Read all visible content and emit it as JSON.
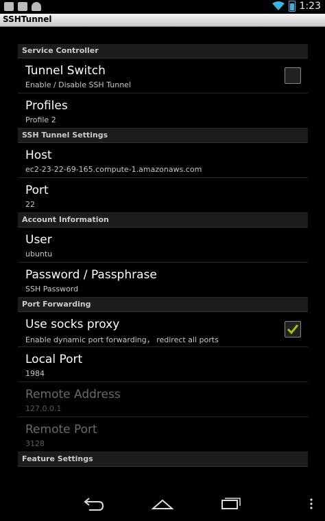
{
  "status_bar": {
    "time": "1:23",
    "left_icons": [
      "gallery-icon",
      "keyboard-icon",
      "android-icon"
    ],
    "right_icons": [
      "wifi-icon",
      "battery-icon"
    ]
  },
  "app": {
    "title": "SSHTunnel"
  },
  "sections": [
    {
      "header": "Service Controller",
      "items": [
        {
          "title": "Tunnel Switch",
          "summary": "Enable / Disable SSH Tunnel",
          "checkbox": true,
          "checked": false
        },
        {
          "title": "Profiles",
          "summary": "Profile 2"
        }
      ]
    },
    {
      "header": "SSH Tunnel Settings",
      "items": [
        {
          "title": "Host",
          "summary": "ec2-23-22-69-165.compute-1.amazonaws.com"
        },
        {
          "title": "Port",
          "summary": "22"
        }
      ]
    },
    {
      "header": "Account Information",
      "items": [
        {
          "title": "User",
          "summary": "ubuntu"
        },
        {
          "title": "Password / Passphrase",
          "summary": "SSH Password"
        }
      ]
    },
    {
      "header": "Port Forwarding",
      "items": [
        {
          "title": "Use socks proxy",
          "summary": "Enable dynamic port forwarding， redirect all ports",
          "checkbox": true,
          "checked": true
        },
        {
          "title": "Local Port",
          "summary": "1984"
        },
        {
          "title": "Remote Address",
          "summary": "127.0.0.1",
          "disabled": true
        },
        {
          "title": "Remote Port",
          "summary": "3128",
          "disabled": true
        }
      ]
    },
    {
      "header": "Feature Settings",
      "items": []
    }
  ],
  "colors": {
    "accent": "#33b5e5",
    "check": "#99cc00",
    "category_bg": "#1c1c1c"
  },
  "nav_bar": {
    "buttons": [
      "back-icon",
      "home-icon",
      "recents-icon",
      "overflow-menu-icon"
    ]
  }
}
